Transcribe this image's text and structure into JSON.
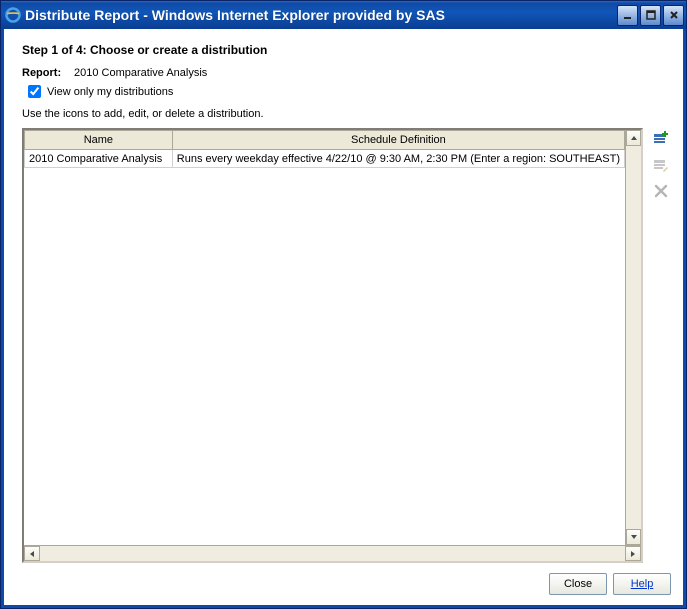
{
  "window": {
    "title": "Distribute Report - Windows Internet Explorer provided by SAS"
  },
  "wizard": {
    "step_title": "Step 1 of 4: Choose or create a distribution",
    "report_label": "Report:",
    "report_name": "2010 Comparative Analysis",
    "view_only_label": "View only my distributions",
    "view_only_checked": true,
    "instruction": "Use the icons to add, edit, or delete a distribution."
  },
  "grid": {
    "headers": {
      "name": "Name",
      "schedule": "Schedule Definition"
    },
    "rows": [
      {
        "name": "2010 Comparative Analysis",
        "schedule": "Runs every weekday effective 4/22/10 @ 9:30 AM, 2:30 PM (Enter a region: SOUTHEAST)"
      }
    ]
  },
  "actions": {
    "add": "add-distribution",
    "edit": "edit-distribution",
    "delete": "delete-distribution"
  },
  "footer": {
    "close": "Close",
    "help": "Help"
  }
}
